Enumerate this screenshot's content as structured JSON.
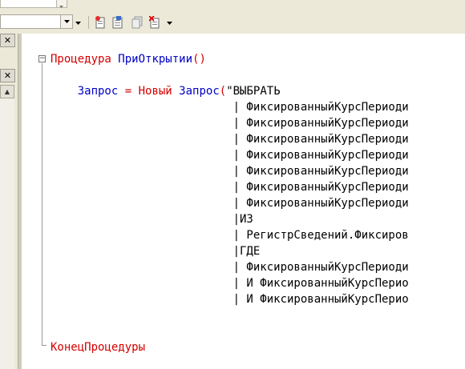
{
  "toolbar": {
    "selector_value": "",
    "module_selector_value": ""
  },
  "icons": {
    "insert": "insert-icon",
    "new_module": "new-module-icon",
    "copy": "copy-icon",
    "delete": "delete-icon",
    "dropdown": "chevron-down-icon"
  },
  "left_panel": {
    "close_label": "✕",
    "close2_label": "✕",
    "scroll_up": "▲"
  },
  "editor": {
    "lines": [
      {
        "parts": [
          {
            "t": "Процедура ",
            "c": "kw"
          },
          {
            "t": "ПриОткрытии",
            "c": "id"
          },
          {
            "t": "()",
            "c": "kw"
          }
        ]
      },
      {
        "parts": []
      },
      {
        "parts": [
          {
            "t": "    Запрос",
            "c": "id"
          },
          {
            "t": " = ",
            "c": "op"
          },
          {
            "t": "Новый ",
            "c": "kw"
          },
          {
            "t": "Запрос",
            "c": "id"
          },
          {
            "t": "(",
            "c": "op"
          },
          {
            "t": "\"ВЫБРАТЬ",
            "c": "str"
          }
        ]
      },
      {
        "parts": [
          {
            "t": "                           | ФиксированныйКурсПериоди",
            "c": "str"
          }
        ]
      },
      {
        "parts": [
          {
            "t": "                           | ФиксированныйКурсПериоди",
            "c": "str"
          }
        ]
      },
      {
        "parts": [
          {
            "t": "                           | ФиксированныйКурсПериоди",
            "c": "str"
          }
        ]
      },
      {
        "parts": [
          {
            "t": "                           | ФиксированныйКурсПериоди",
            "c": "str"
          }
        ]
      },
      {
        "parts": [
          {
            "t": "                           | ФиксированныйКурсПериоди",
            "c": "str"
          }
        ]
      },
      {
        "parts": [
          {
            "t": "                           | ФиксированныйКурсПериоди",
            "c": "str"
          }
        ]
      },
      {
        "parts": [
          {
            "t": "                           | ФиксированныйКурсПериоди",
            "c": "str"
          }
        ]
      },
      {
        "parts": [
          {
            "t": "                           |ИЗ",
            "c": "str"
          }
        ]
      },
      {
        "parts": [
          {
            "t": "                           | РегистрСведений.Фиксиров",
            "c": "str"
          }
        ]
      },
      {
        "parts": [
          {
            "t": "                           |ГДЕ",
            "c": "str"
          }
        ]
      },
      {
        "parts": [
          {
            "t": "                           | ФиксированныйКурсПериоди",
            "c": "str"
          }
        ]
      },
      {
        "parts": [
          {
            "t": "                           | И ФиксированныйКурсПерио",
            "c": "str"
          }
        ]
      },
      {
        "parts": [
          {
            "t": "                           | И ФиксированныйКурсПерио",
            "c": "str"
          }
        ]
      },
      {
        "parts": []
      },
      {
        "parts": []
      },
      {
        "parts": [
          {
            "t": "КонецПроцедуры",
            "c": "kw"
          }
        ]
      }
    ]
  }
}
